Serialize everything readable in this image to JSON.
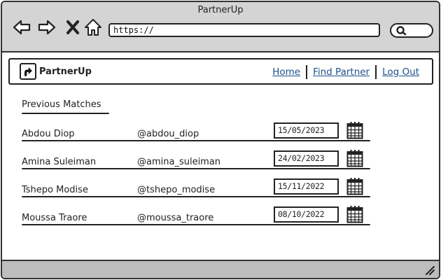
{
  "window": {
    "title": "PartnerUp"
  },
  "browser": {
    "url": "https://",
    "back_icon": "arrow-left-icon",
    "forward_icon": "arrow-right-icon",
    "stop_icon": "close-icon",
    "home_icon": "home-icon",
    "search_icon": "search-icon"
  },
  "header": {
    "brand": "PartnerUp",
    "logo_icon": "arrow-up-logo-icon",
    "nav": [
      {
        "label": "Home"
      },
      {
        "label": "Find Partner"
      },
      {
        "label": "Log Out"
      }
    ]
  },
  "matches": {
    "title": "Previous Matches",
    "rows": [
      {
        "name": "Abdou Diop",
        "handle": "@abdou_diop",
        "date": "15/05/2023"
      },
      {
        "name": "Amina Suleiman",
        "handle": "@amina_suleiman",
        "date": "24/02/2023"
      },
      {
        "name": "Tshepo Modise",
        "handle": "@tshepo_modise",
        "date": "15/11/2022"
      },
      {
        "name": "Moussa Traore",
        "handle": "@moussa_traore",
        "date": "08/10/2022"
      }
    ]
  },
  "colors": {
    "link": "#1f4f8a",
    "chrome": "#d4d4d4",
    "statusbar": "#bdbdbd"
  }
}
